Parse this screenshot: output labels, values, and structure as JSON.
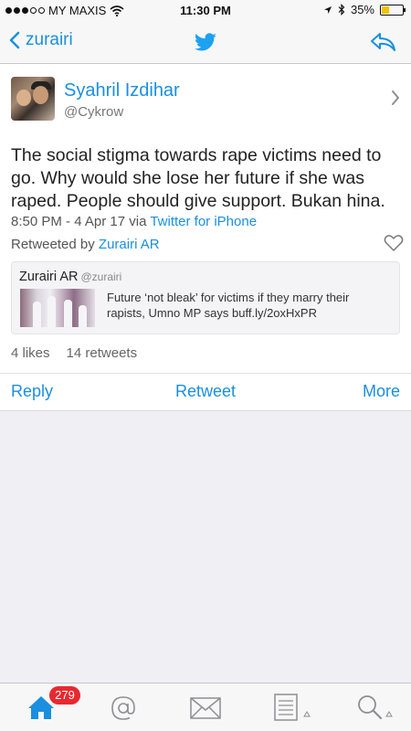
{
  "status_bar": {
    "carrier": "MY MAXIS",
    "time": "11:30 PM",
    "battery_percent": "35%",
    "battery_level": 0.35
  },
  "nav": {
    "back_label": "zurairi",
    "accent_color": "#1a8fe0"
  },
  "tweet": {
    "author_name": "Syahril Izdihar",
    "author_handle": "@Cykrow",
    "text": "The social stigma towards rape victims need to go. Why would she lose her future if she was raped. People should give support. Bukan hina.",
    "timestamp": "8:50 PM - 4 Apr 17 via",
    "source": "Twitter for iPhone",
    "retweeted_by_prefix": "Retweeted by",
    "retweeted_by_name": "Zurairi AR",
    "quoted": {
      "author_name": "Zurairi AR",
      "author_handle": "@zurairi",
      "text": "Future ‘not bleak’ for victims if they marry their rapists, Umno MP says buff.ly/2oxHxPR"
    },
    "likes": "4 likes",
    "retweets": "14 retweets"
  },
  "actions": {
    "reply": "Reply",
    "retweet": "Retweet",
    "more": "More"
  },
  "tab_bar": {
    "home_badge": "279",
    "icons": [
      "home-icon",
      "mentions-icon",
      "messages-icon",
      "lists-icon",
      "search-icon"
    ]
  }
}
